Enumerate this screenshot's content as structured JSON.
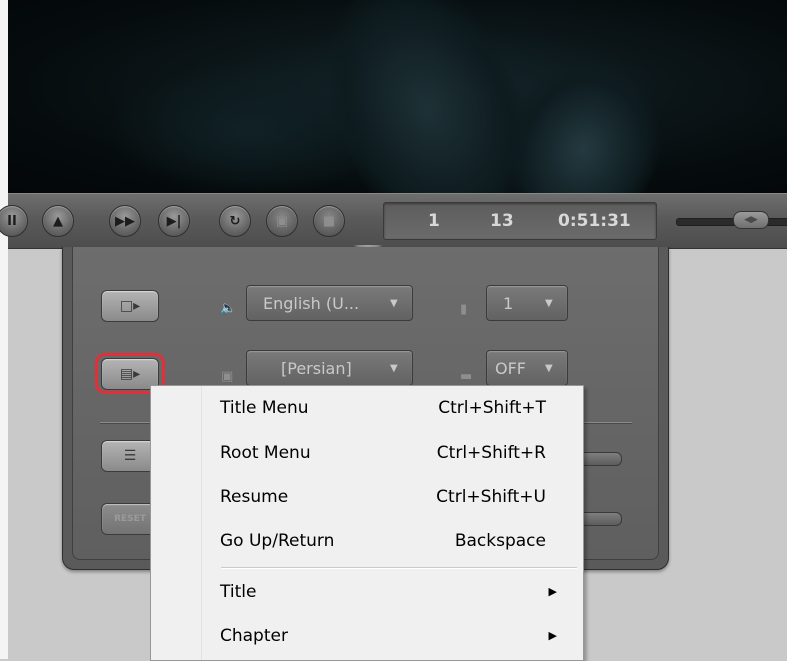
{
  "player": {
    "time": {
      "title": "1",
      "chapter": "13",
      "elapsed": "0:51:31"
    }
  },
  "panel": {
    "audio_dropdown": "English (U...",
    "angle_dropdown": "1",
    "subtitle_dropdown": "[Persian]",
    "cc_dropdown": "OFF",
    "reset_label": "RESET"
  },
  "context_menu": {
    "items": [
      {
        "label": "Title Menu",
        "shortcut": "Ctrl+Shift+T"
      },
      {
        "label": "Root Menu",
        "shortcut": "Ctrl+Shift+R"
      },
      {
        "label": "Resume",
        "shortcut": "Ctrl+Shift+U"
      },
      {
        "label": "Go Up/Return",
        "shortcut": "Backspace"
      },
      {
        "label": "Title",
        "submenu": true
      },
      {
        "label": "Chapter",
        "submenu": true
      }
    ]
  },
  "colors": {
    "highlight_ring": "#e0303a",
    "menu_background": "#f0f0f0",
    "panel": "#5a5a5a"
  },
  "icons": [
    "play-pause-icon",
    "open-icon",
    "fast-forward-icon",
    "next-icon",
    "repeat-icon",
    "menu-icon",
    "stop-icon",
    "volume-icon",
    "snapshot-icon",
    "dvd-menu-icon",
    "audio-icon",
    "angle-icon",
    "subtitle-icon",
    "cc-icon",
    "list-icon",
    "submenu-arrow-icon"
  ]
}
